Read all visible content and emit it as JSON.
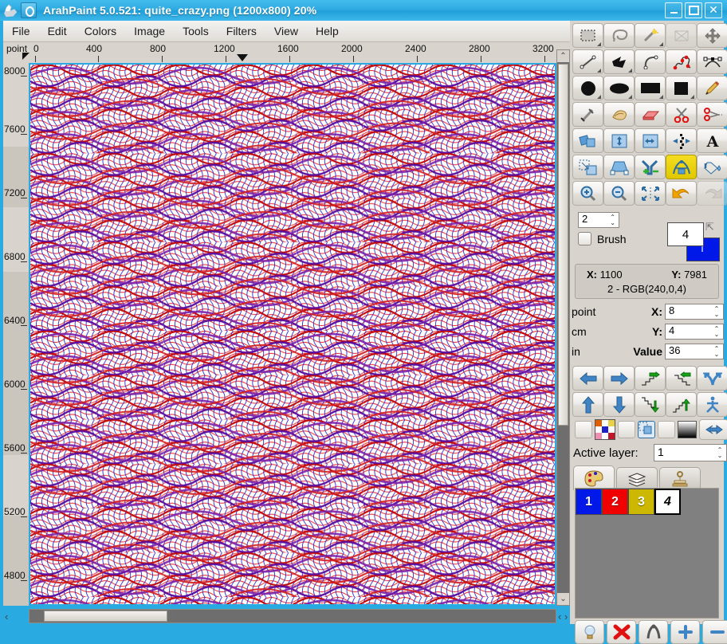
{
  "window": {
    "title": "ArahPaint 5.0.521: quite_crazy.png  (1200x800) 20%",
    "minimize": "–",
    "maximize": "□",
    "close": "✕",
    "app_icon": "arahpaint-logo-icon",
    "doc_icon": "document-icon"
  },
  "menu": {
    "items": [
      "File",
      "Edit",
      "Colors",
      "Image",
      "Tools",
      "Filters",
      "View",
      "Help"
    ]
  },
  "rulers": {
    "unit_label": "point",
    "horizontal_ticks": [
      "0",
      "400",
      "800",
      "1200",
      "1600",
      "2000",
      "2400",
      "2800",
      "3200"
    ],
    "vertical_ticks": [
      "8000",
      "7600",
      "7200",
      "6800",
      "6400",
      "6000",
      "5600",
      "5200",
      "4800"
    ]
  },
  "toolbar": {
    "rows": [
      [
        {
          "name": "rectangle-select-tool",
          "label": "Rectangle select"
        },
        {
          "name": "lasso-select-tool",
          "label": "Lasso select"
        },
        {
          "name": "magic-wand-tool",
          "label": "Magic wand"
        },
        {
          "name": "transform-select-tool",
          "label": "Transform selection"
        },
        {
          "name": "move-tool",
          "label": "Move"
        }
      ],
      [
        {
          "name": "line-tool",
          "label": "Line"
        },
        {
          "name": "polygon-tool",
          "label": "Polygon"
        },
        {
          "name": "curve-tool",
          "label": "Curve"
        },
        {
          "name": "freehand-node-tool",
          "label": "Freehand nodes"
        },
        {
          "name": "bezier-tool",
          "label": "Bezier"
        }
      ],
      [
        {
          "name": "filled-circle-tool",
          "label": "Filled circle"
        },
        {
          "name": "filled-ellipse-tool",
          "label": "Filled ellipse"
        },
        {
          "name": "rectangle-outline-tool",
          "label": "Rectangle"
        },
        {
          "name": "filled-rectangle-tool",
          "label": "Filled rectangle"
        },
        {
          "name": "pencil-tool",
          "label": "Pencil"
        }
      ],
      [
        {
          "name": "airbrush-tool",
          "label": "Airbrush"
        },
        {
          "name": "smudge-tool",
          "label": "Smudge"
        },
        {
          "name": "eraser-tool",
          "label": "Eraser"
        },
        {
          "name": "scissors-tool",
          "label": "Scissors"
        },
        {
          "name": "cut-dashed-tool",
          "label": "Cut along dashes"
        }
      ],
      [
        {
          "name": "copy-layer-tool",
          "label": "Copy layer"
        },
        {
          "name": "flip-vertical-tool",
          "label": "Flip vertical"
        },
        {
          "name": "flip-horizontal-tool",
          "label": "Flip horizontal"
        },
        {
          "name": "mirror-repeat-tool",
          "label": "Mirror repeat"
        },
        {
          "name": "text-tool",
          "label": "Text"
        }
      ],
      [
        {
          "name": "scale-tool",
          "label": "Scale"
        },
        {
          "name": "perspective-tool",
          "label": "Perspective"
        },
        {
          "name": "merge-split-tool",
          "label": "Merge / split"
        },
        {
          "name": "weave-tool",
          "label": "Weave editor"
        },
        {
          "name": "fill-bucket-tool",
          "label": "Fill bucket"
        }
      ],
      [
        {
          "name": "zoom-in-tool",
          "label": "Zoom in"
        },
        {
          "name": "zoom-out-tool",
          "label": "Zoom out"
        },
        {
          "name": "fit-to-window-tool",
          "label": "Fit to window"
        },
        {
          "name": "undo-tool",
          "label": "Undo"
        },
        {
          "name": "redo-tool",
          "label": "Redo"
        }
      ]
    ]
  },
  "brush": {
    "size": "2",
    "checkbox_label": "Brush",
    "checked": false,
    "fg_color_index": "4",
    "fg_color_hex": "#ffffff",
    "bg_color_hex": "#0019e8",
    "swap_icon": "swap-colors-icon"
  },
  "cursor_info": {
    "x_label": "X:",
    "x_value": "1100",
    "y_label": "Y:",
    "y_value": "7981",
    "color_line": "2 - RGB(240,0,4)"
  },
  "units": [
    {
      "unit": "point",
      "label": "X:",
      "value": "8"
    },
    {
      "unit": "cm",
      "label": "Y:",
      "value": "4"
    },
    {
      "unit": "in",
      "label": "Value",
      "value": "36"
    }
  ],
  "navigation": {
    "rows": [
      [
        {
          "name": "move-left-button",
          "label": "Move left"
        },
        {
          "name": "move-right-button",
          "label": "Move right"
        },
        {
          "name": "shift-steps-right-button",
          "label": "Shift steps right"
        },
        {
          "name": "shift-steps-left-button",
          "label": "Shift steps left"
        },
        {
          "name": "mirror-horizontal-button",
          "label": "Mirror horizontal"
        }
      ],
      [
        {
          "name": "move-up-button",
          "label": "Move up"
        },
        {
          "name": "move-down-button",
          "label": "Move down"
        },
        {
          "name": "shift-steps-down-button",
          "label": "Shift steps down"
        },
        {
          "name": "shift-steps-up-button",
          "label": "Shift steps up"
        },
        {
          "name": "mirror-vertical-button",
          "label": "Mirror vertical"
        }
      ]
    ]
  },
  "misc_row": {
    "items": [
      {
        "name": "empty-square-1-button"
      },
      {
        "name": "palette-grid-button"
      },
      {
        "name": "empty-square-2-button"
      },
      {
        "name": "selection-copy-button"
      },
      {
        "name": "empty-square-3-button"
      },
      {
        "name": "gradient-button"
      },
      {
        "name": "flip-arrow-left-button"
      },
      {
        "name": "flip-arrow-right-button"
      }
    ]
  },
  "active_layer": {
    "label": "Active layer:",
    "value": "1"
  },
  "panel_tabs": [
    {
      "name": "tab-palette",
      "icon": "palette-icon",
      "selected": true
    },
    {
      "name": "tab-layers",
      "icon": "layers-icon",
      "selected": false
    },
    {
      "name": "tab-stamp",
      "icon": "stamp-icon",
      "selected": false
    }
  ],
  "palette": {
    "colors": [
      {
        "index": "1",
        "hex": "#0019e8",
        "selected": false
      },
      {
        "index": "2",
        "hex": "#f00000",
        "selected": false
      },
      {
        "index": "3",
        "hex": "#ccb800",
        "selected": false
      },
      {
        "index": "4",
        "hex": "#ffffff",
        "selected": true
      }
    ],
    "buttons": [
      {
        "name": "color-info-button",
        "icon": "lightbulb-icon"
      },
      {
        "name": "delete-color-button",
        "icon": "red-cross-icon"
      },
      {
        "name": "merge-colors-button",
        "icon": "merge-icon"
      },
      {
        "name": "add-color-button",
        "icon": "plus-icon"
      },
      {
        "name": "remove-color-button",
        "icon": "minus-icon"
      }
    ]
  },
  "scrollbars": {
    "h_left_arrow": "‹",
    "h_right_arrow": "›",
    "v_up_arrow": "⌃",
    "v_down_arrow": "⌄"
  },
  "colors": {
    "titlebar": "#29abe2",
    "panel": "#d8d4cd",
    "ruler": "#d8d4cd",
    "pattern_red": "#e41010",
    "pattern_blue": "#1a1ad0",
    "active_tool": "#e8d000"
  }
}
